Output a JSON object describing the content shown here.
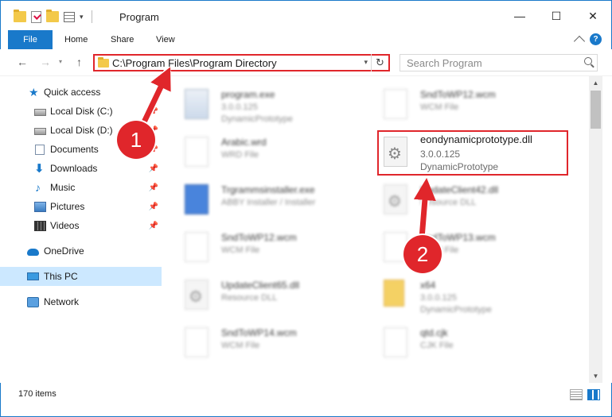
{
  "window": {
    "title": "Program",
    "minimize": "—",
    "maximize": "☐",
    "close": "✕"
  },
  "ribbon": {
    "tabs": [
      "File",
      "Home",
      "Share",
      "View"
    ],
    "help": "?"
  },
  "address": {
    "path": "C:\\Program Files\\Program Directory",
    "refresh": "↻"
  },
  "search": {
    "placeholder": "Search Program"
  },
  "nav": {
    "back": "←",
    "forward": "→",
    "up": "↑",
    "dropdown": "▾"
  },
  "sidebar": {
    "items": [
      {
        "label": "Quick access",
        "icon": "star-icon",
        "pinned": false
      },
      {
        "label": "Local Disk (C:)",
        "icon": "disk-icon",
        "pinned": true
      },
      {
        "label": "Local Disk (D:)",
        "icon": "disk-icon",
        "pinned": true
      },
      {
        "label": "Documents",
        "icon": "documents-icon",
        "pinned": true
      },
      {
        "label": "Downloads",
        "icon": "download-icon",
        "pinned": true
      },
      {
        "label": "Music",
        "icon": "music-icon",
        "pinned": true
      },
      {
        "label": "Pictures",
        "icon": "pictures-icon",
        "pinned": true
      },
      {
        "label": "Videos",
        "icon": "videos-icon",
        "pinned": true
      },
      {
        "label": "OneDrive",
        "icon": "cloud-icon",
        "pinned": false
      },
      {
        "label": "This PC",
        "icon": "computer-icon",
        "pinned": false,
        "selected": true
      },
      {
        "label": "Network",
        "icon": "network-icon",
        "pinned": false
      }
    ]
  },
  "files": [
    {
      "name": "program.exe",
      "meta1": "3.0.0.125",
      "meta2": "DynamicPrototype",
      "icon": "exe-icon"
    },
    {
      "name": "SndToWP12.wcm",
      "meta1": "WCM File",
      "meta2": "",
      "icon": "file-icon"
    },
    {
      "name": "Arabic.wrd",
      "meta1": "WRD File",
      "meta2": "",
      "icon": "file-icon"
    },
    {
      "name": "eondynamicprototype.dll",
      "meta1": "3.0.0.125",
      "meta2": "DynamicPrototype",
      "icon": "dll-gear-icon",
      "highlight": true
    },
    {
      "name": "Trgrammsinstaller.exe",
      "meta1": "ABBY Installer / Installer",
      "meta2": "",
      "icon": "exe-icon"
    },
    {
      "name": "UpdateClient42.dll",
      "meta1": "Resource DLL",
      "meta2": "",
      "icon": "dll-gear-icon"
    },
    {
      "name": "SndToWP12.wcm",
      "meta1": "WCM File",
      "meta2": "",
      "icon": "file-icon"
    },
    {
      "name": "SndToWP13.wcm",
      "meta1": "WCM File",
      "meta2": "",
      "icon": "file-icon"
    },
    {
      "name": "UpdateClient65.dll",
      "meta1": "Resource DLL",
      "meta2": "",
      "icon": "dll-gear-icon"
    },
    {
      "name": "x64",
      "meta1": "3.0.0.125",
      "meta2": "DynamicPrototype",
      "icon": "folder-icon"
    },
    {
      "name": "SndToWP14.wcm",
      "meta1": "WCM File",
      "meta2": "",
      "icon": "file-icon"
    },
    {
      "name": "qtd.cjk",
      "meta1": "CJK File",
      "meta2": "",
      "icon": "file-icon"
    }
  ],
  "status": {
    "count": "170 items"
  },
  "annotations": {
    "step1": "1",
    "step2": "2"
  },
  "colors": {
    "accent": "#1979ca",
    "highlight": "#e0262b",
    "selected": "#cce8ff"
  }
}
